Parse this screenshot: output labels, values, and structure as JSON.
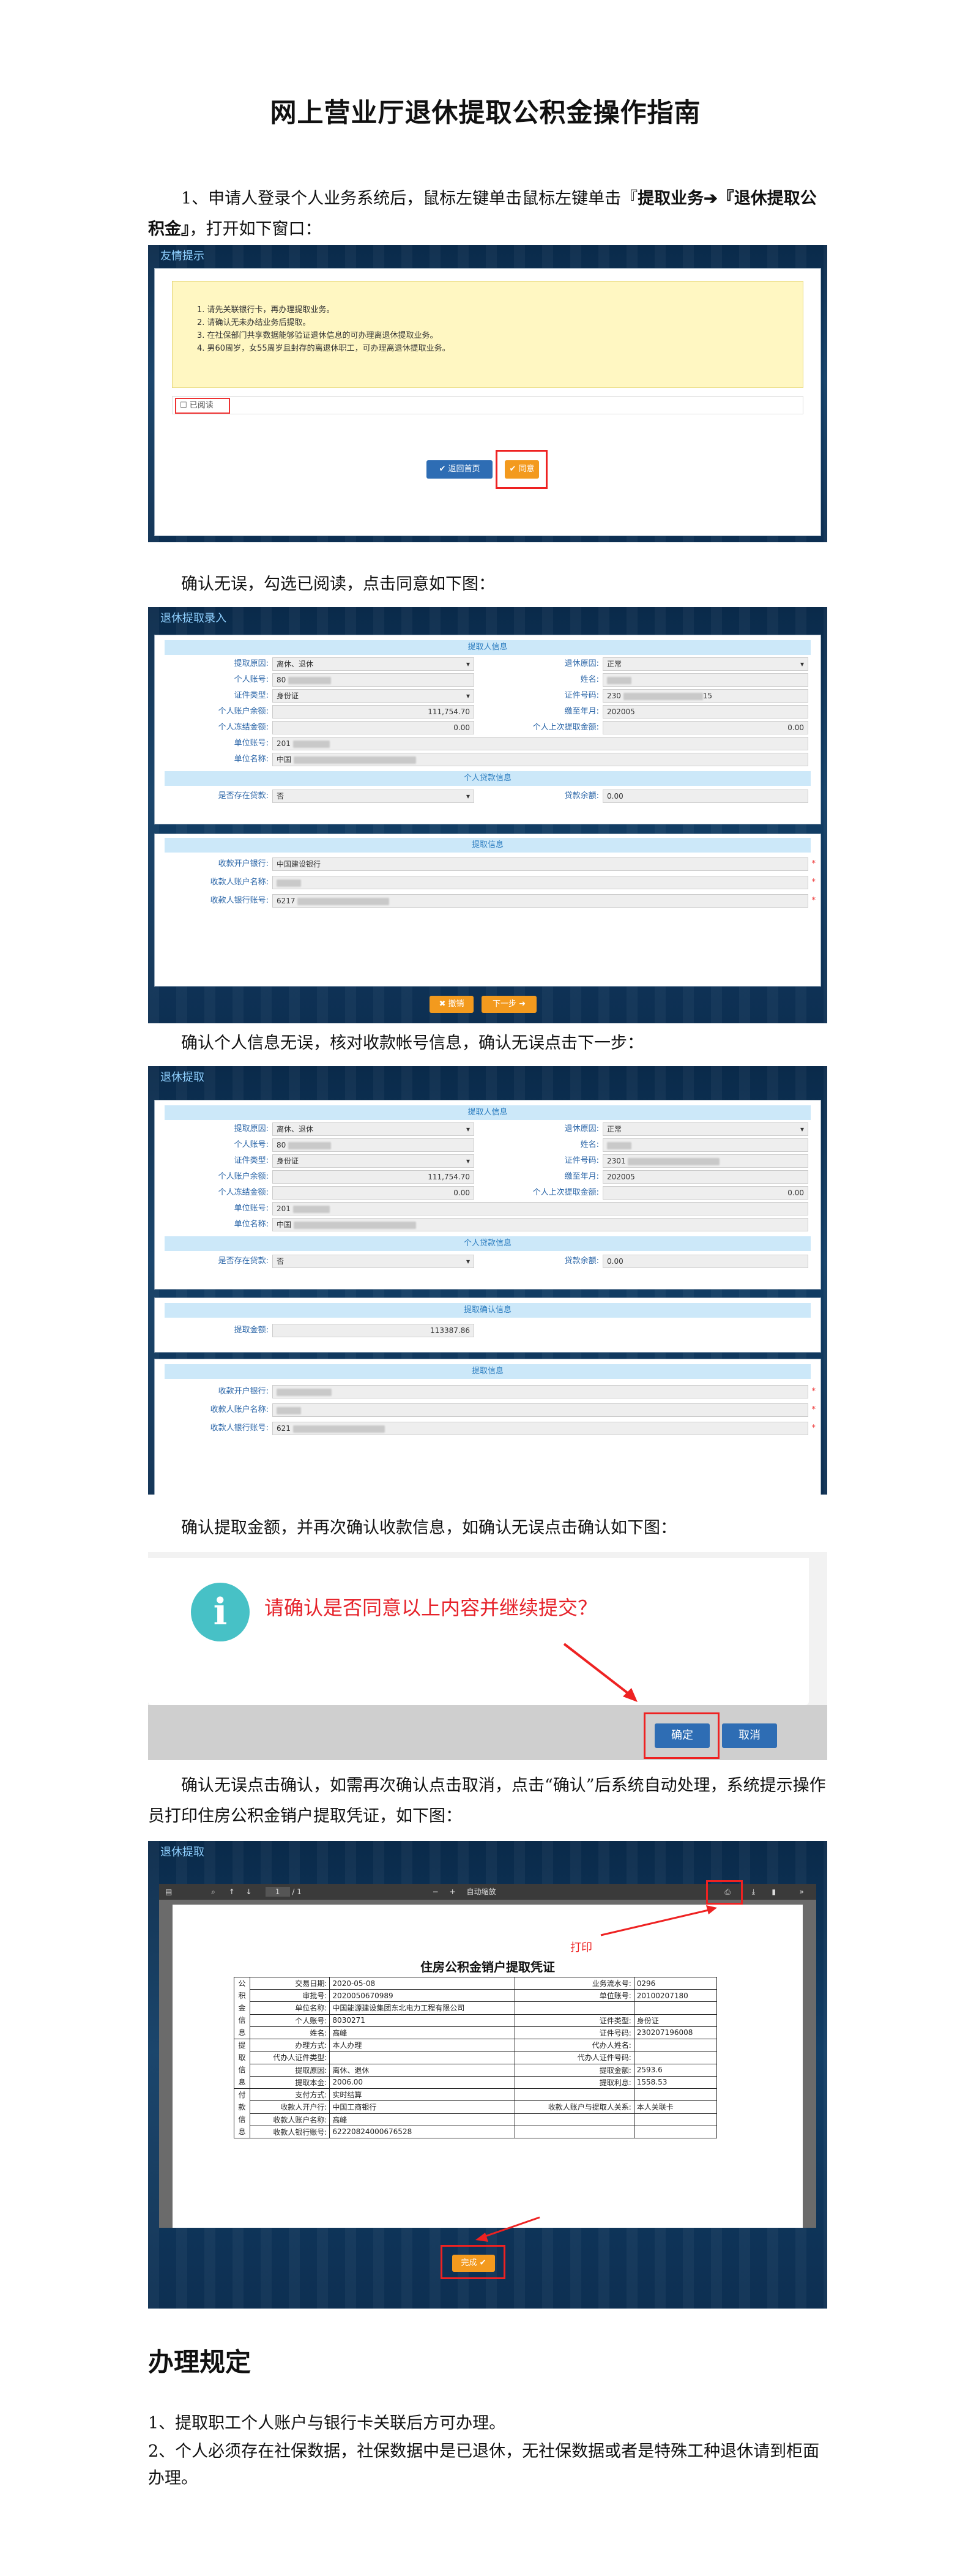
{
  "title": "网上营业厅退休提取公积金操作指南",
  "step1": {
    "text_a": "1、申请人登录个人业务系统后，鼠标左键单击鼠标左键单击『",
    "bold": "提取业务➔『退休提取公积金』",
    "text_b": "，打开如下窗口："
  },
  "step2": "确认无误，勾选已阅读，点击同意如下图：",
  "step3": "确认个人信息无误，核对收款帐号信息，确认无误点击下一步：",
  "step4": "确认提取金额，并再次确认收款信息，如确认无误点击确认如下图：",
  "step5": "确认无误点击确认，如需再次确认点击取消，点击“确认”后系统自动处理，系统提示操作员打印住房公积金销户提取凭证，如下图：",
  "shot1": {
    "title": "友情提示",
    "notices": [
      "1. 请先关联银行卡，再办理提取业务。",
      "2. 请确认无未办结业务后提取。",
      "3. 在社保部门共享数据能够验证退休信息的可办理离退休提取业务。",
      "4. 男60周岁，女55周岁且封存的离退休职工，可办理离退休提取业务。"
    ],
    "read_label": "已阅读",
    "back_button": "返回首页",
    "agree_button": "同意"
  },
  "form": {
    "header_a": "退休提取录入",
    "header_b": "退休提取",
    "section_applicant": "提取人信息",
    "section_loan": "个人贷款信息",
    "section_confirm": "提取确认信息",
    "section_payee": "提取信息",
    "labels": {
      "reason": "提取原因:",
      "account": "个人账号:",
      "id_type": "证件类型:",
      "balance": "个人账户余额:",
      "frozen": "个人冻结金额:",
      "unit_no": "单位账号:",
      "unit_name": "单位名称:",
      "retire_reason": "退休原因:",
      "name": "姓名:",
      "id_no": "证件号码:",
      "paid_to": "缴至年月:",
      "last_pay": "个人上次提取金额:",
      "has_loan": "是否存在贷款:",
      "loan_balance": "贷款余额:",
      "withdraw_amount": "提取金额:",
      "bank": "收款开户银行:",
      "payee_name": "收款人账户名称:",
      "payee_account": "收款人银行账号:"
    },
    "values": {
      "reason": "离休、退休",
      "account": "80",
      "id_type": "身份证",
      "balance": "111,754.70",
      "frozen": "0.00",
      "unit_no": "201",
      "unit_name": "中国",
      "retire_reason": "正常",
      "id_no": "230",
      "id_no_tail": "15",
      "id_no_b": "2301",
      "paid_to": "202005",
      "last_pay": "0.00",
      "has_loan": "否",
      "loan_balance": "0.00",
      "withdraw_amount": "113387.86",
      "bank": "中国建设银行",
      "payee_account": "6217",
      "payee_account_b": "621"
    },
    "cancel_button": "撤销",
    "next_button": "下一步"
  },
  "dialog": {
    "message": "请确认是否同意以上内容并继续提交？",
    "ok": "确定",
    "cancel": "取消"
  },
  "voucher": {
    "header": "退休提取",
    "page_no": "1",
    "page_total": "/ 1",
    "zoom": "自动缩放",
    "print_label": "打印",
    "doc_title": "住房公积金销户提取凭证",
    "group_labels": [
      "公积金信息",
      "提取信息",
      "付款信息"
    ],
    "rows": [
      [
        "交易日期:",
        "2020-05-08",
        "业务流水号:",
        "0296"
      ],
      [
        "审批号:",
        "2020050670989",
        "单位账号:",
        "20100207180"
      ],
      [
        "单位名称:",
        "中国能源建设集团东北电力工程有限公司",
        "",
        ""
      ],
      [
        "个人账号:",
        "8030271",
        "证件类型:",
        "身份证"
      ],
      [
        "姓名:",
        "高峰",
        "证件号码:",
        "230207196008"
      ],
      [
        "办理方式:",
        "本人办理",
        "代办人姓名:",
        ""
      ],
      [
        "代办人证件类型:",
        "",
        "代办人证件号码:",
        ""
      ],
      [
        "提取原因:",
        "离休、退休",
        "提取金额:",
        "2593.6"
      ],
      [
        "提取本金:",
        "2006.00",
        "提取利息:",
        "1558.53"
      ],
      [
        "支付方式:",
        "实时结算",
        "",
        ""
      ],
      [
        "收款人开户行:",
        "中国工商银行",
        "收款人账户与提取人关系:",
        "本人关联卡"
      ],
      [
        "收款人账户名称:",
        "高峰",
        "",
        ""
      ],
      [
        "收款人银行账号:",
        "62220824000676528",
        "",
        ""
      ]
    ],
    "done_button": "完成"
  },
  "rules": {
    "heading": "办理规定",
    "items": [
      "1、提取职工个人账户与银行卡关联后方可办理。",
      "2、个人必须存在社保数据，社保数据中是已退休，无社保数据或者是特殊工种退休请到柜面办理。"
    ]
  }
}
